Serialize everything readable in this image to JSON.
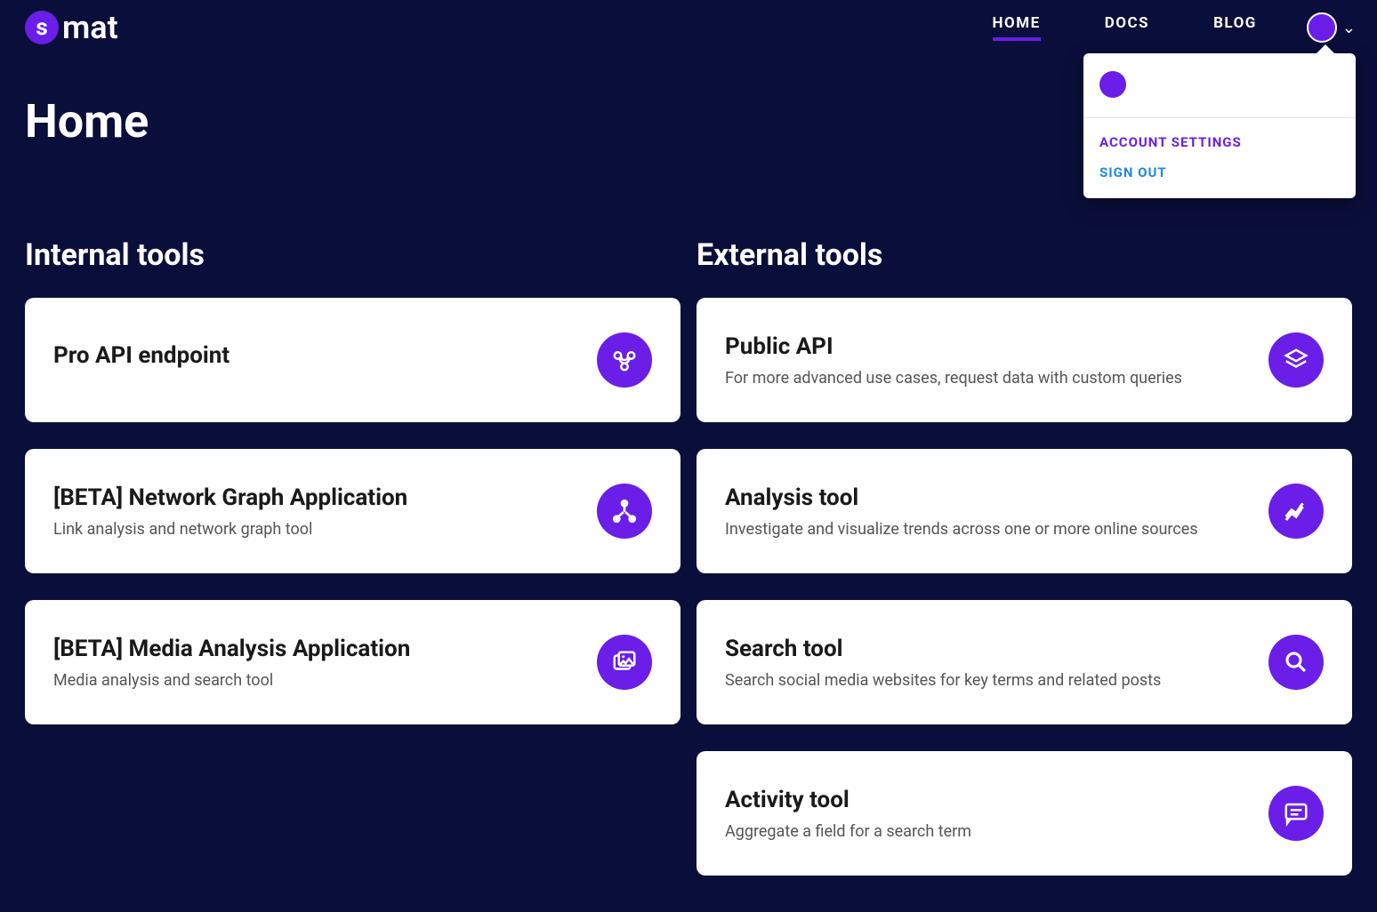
{
  "brand": {
    "mark": "s",
    "text": "mat"
  },
  "nav": {
    "home": "HOME",
    "docs": "DOCS",
    "blog": "BLOG"
  },
  "dropdown": {
    "account_settings": "ACCOUNT SETTINGS",
    "sign_out": "SIGN OUT"
  },
  "page_title": "Home",
  "columns": {
    "internal": {
      "title": "Internal tools",
      "cards": [
        {
          "title": "Pro API endpoint",
          "desc": "",
          "icon": "api-icon"
        },
        {
          "title": "[BETA] Network Graph Application",
          "desc": "Link analysis and network graph tool",
          "icon": "graph-icon"
        },
        {
          "title": "[BETA] Media Analysis Application",
          "desc": "Media analysis and search tool",
          "icon": "media-icon"
        }
      ]
    },
    "external": {
      "title": "External tools",
      "cards": [
        {
          "title": "Public API",
          "desc": "For more advanced use cases, request data with custom queries",
          "icon": "layers-icon"
        },
        {
          "title": "Analysis tool",
          "desc": "Investigate and visualize trends across one or more online sources",
          "icon": "trend-icon"
        },
        {
          "title": "Search tool",
          "desc": "Search social media websites for key terms and related posts",
          "icon": "search-icon"
        },
        {
          "title": "Activity tool",
          "desc": "Aggregate a field for a search term",
          "icon": "chat-icon"
        }
      ]
    }
  }
}
